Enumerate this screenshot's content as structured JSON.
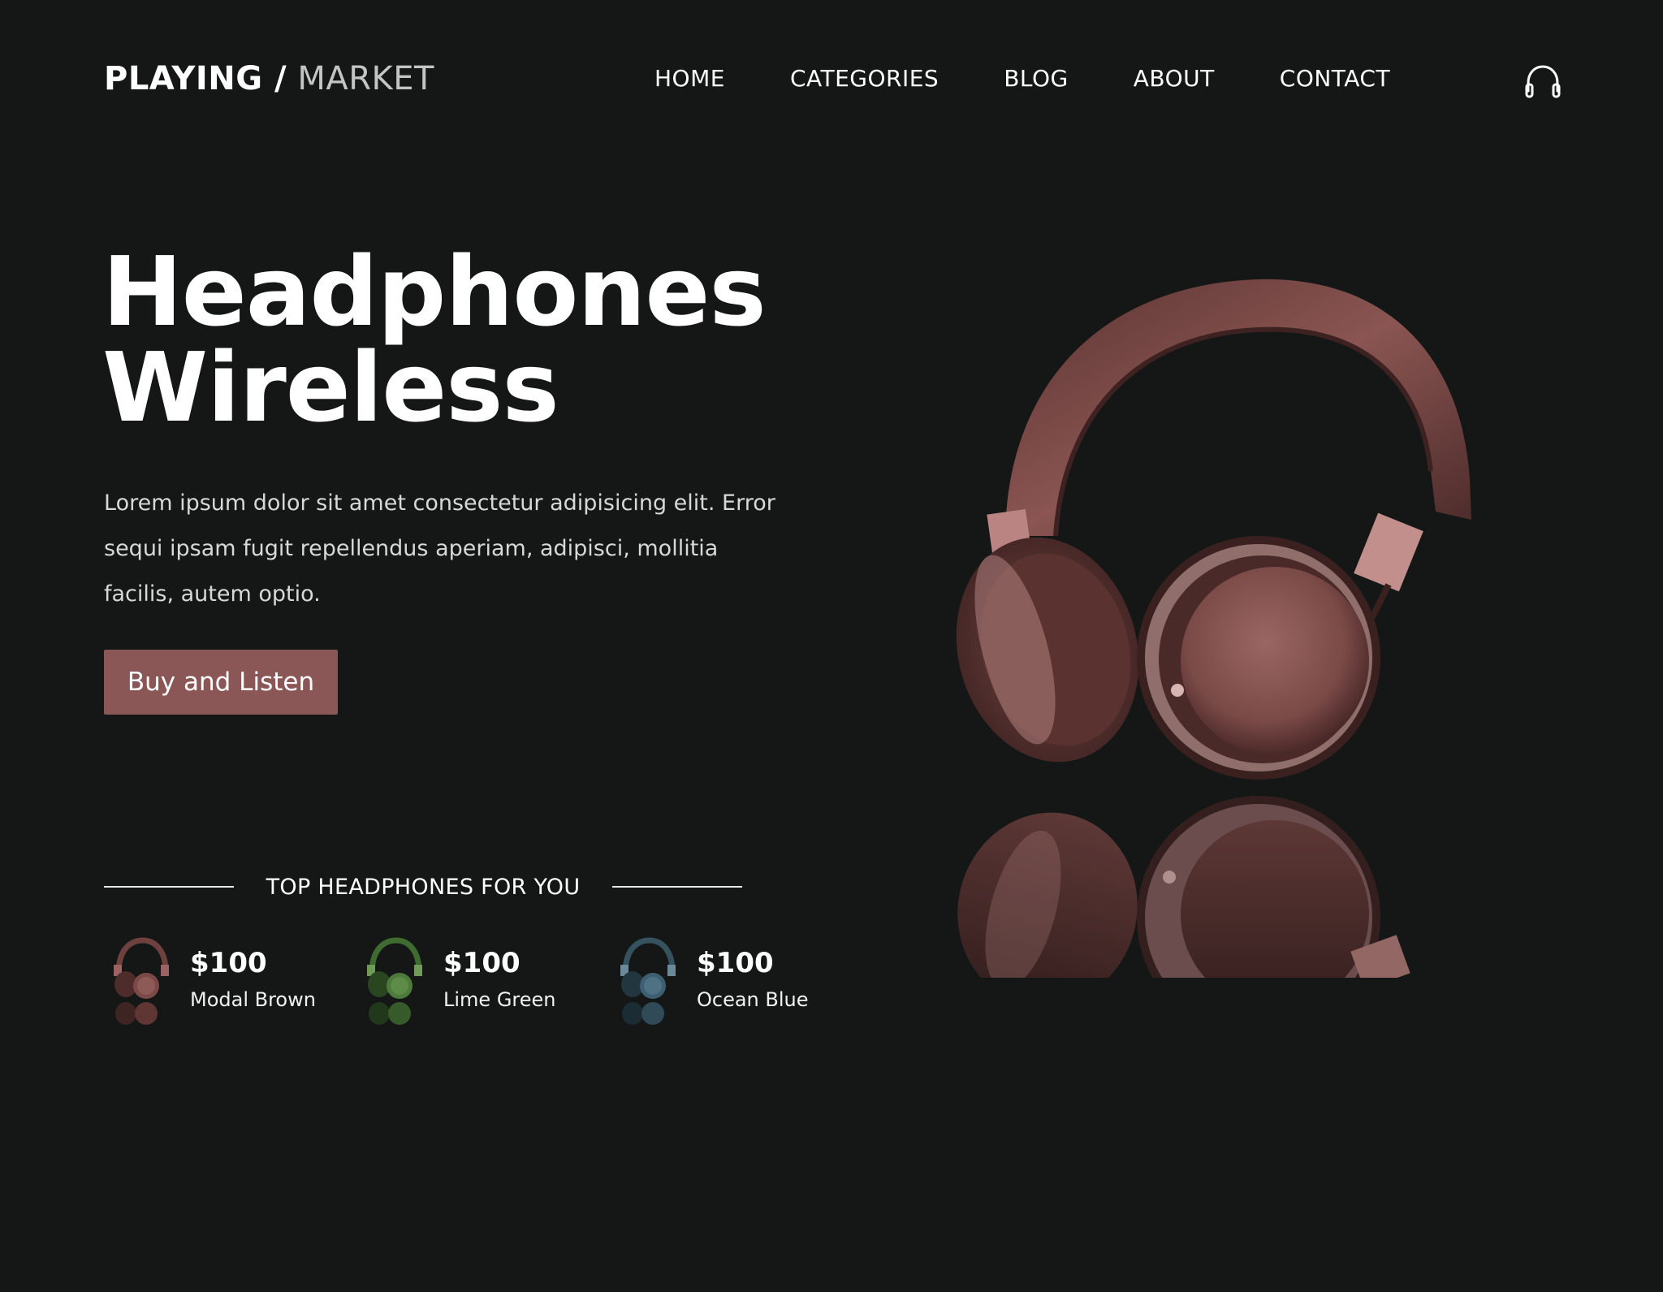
{
  "brand": {
    "strong": "PLAYING /",
    "light": "MARKET"
  },
  "nav": {
    "home": "HOME",
    "categories": "CATEGORIES",
    "blog": "BLOG",
    "about": "ABOUT",
    "contact": "CONTACT"
  },
  "header_icon": "headphones-icon",
  "hero": {
    "title_line1": "Headphones",
    "title_line2": "Wireless",
    "description": "Lorem ipsum dolor sit amet consectetur adipisicing elit. Error sequi ipsam fugit repellendus aperiam, adipisci, mollitia facilis, autem optio.",
    "cta": "Buy and Listen"
  },
  "top_section": {
    "title": "TOP HEADPHONES FOR YOU",
    "products": [
      {
        "price": "$100",
        "name": "Modal Brown",
        "color": "#7a4a48"
      },
      {
        "price": "$100",
        "name": "Lime Green",
        "color": "#4d7a3a"
      },
      {
        "price": "$100",
        "name": "Ocean Blue",
        "color": "#3e5f70"
      }
    ]
  },
  "colors": {
    "background": "#151717",
    "accent": "#8a5656",
    "hero_headphone": "#7d4a47"
  }
}
